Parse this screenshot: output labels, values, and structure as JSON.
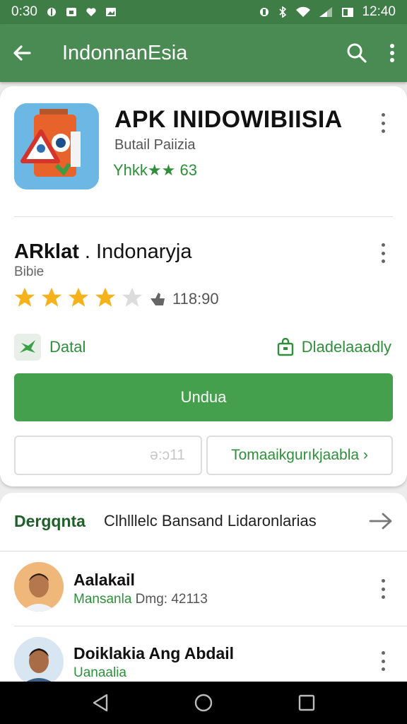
{
  "status": {
    "time_left": "0:30",
    "time_right": "12:40"
  },
  "appbar": {
    "title": "IndonnanEsia",
    "back_icon": "arrow-left-icon",
    "search_icon": "search-icon",
    "more_icon": "more-vert-icon"
  },
  "app": {
    "name": "APK INIDOWIBIISIA",
    "developer": "Butail Paiizia",
    "rating_text": "Yhkk★★ 63",
    "subtitle_bold": "ARklat",
    "subtitle_rest": ". Indonaryja",
    "category": "Bibie",
    "rating_value": 4,
    "rating_max": 5,
    "reviews_count": "118:90"
  },
  "badges": {
    "data_label": "Datal",
    "download_label": "Dladelaaadly"
  },
  "buttons": {
    "install": "Undua",
    "secondary_left": "ǝ:ɔ11",
    "secondary_right": "Tomaaikgurıkjaabla ›"
  },
  "section": {
    "label": "Dergqnta",
    "description": "Clhlllelc Bansand Lidaronlarias"
  },
  "reviews": [
    {
      "name": "Aalakail",
      "meta_green": "Mansanla",
      "meta_gray": "Dmg: 42113"
    },
    {
      "name": "Doiklakia Ang Abdail",
      "meta_green": "Uanaalia",
      "meta_gray": ""
    }
  ],
  "colors": {
    "appbar": "#4a8b53",
    "statusbar": "#3f7d47",
    "accent": "#44a04c",
    "green_text": "#2e8f3a",
    "star": "#f5b21a"
  }
}
